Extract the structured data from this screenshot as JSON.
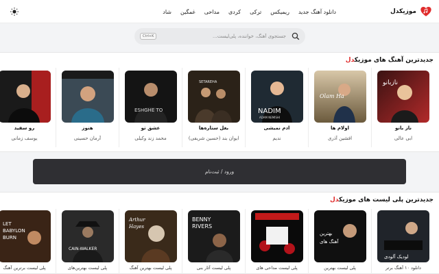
{
  "header": {
    "brand": "موزیکدل",
    "nav": [
      "دانلود آهنگ جدید",
      "ریمیکس",
      "ترکی",
      "کردی",
      "مداحی",
      "غمگین",
      "شاد"
    ],
    "theme_icon": "sun-icon",
    "logo_color": "#e02b2b"
  },
  "search": {
    "placeholder": "جستجوی آهنگ، خواننده، پلی‌لیست...",
    "shortcut": "Ctrl+K"
  },
  "latest_songs": {
    "title_main": "جدیدترین آهنگ های موزیک",
    "title_accent": "دل",
    "items": [
      {
        "title": "ناز بانو",
        "artist": "ابی عالی"
      },
      {
        "title": "اولام ها",
        "artist": "افشین آذری"
      },
      {
        "title": "آدم نمیشی",
        "artist": "ندیم"
      },
      {
        "title": "بغل ستاره‌ها",
        "artist": "ایوان بند (حسین شریفی)"
      },
      {
        "title": "عشق تو",
        "artist": "محمد زند وکیلی"
      },
      {
        "title": "هنوز",
        "artist": "آرمان حسینی"
      },
      {
        "title": "رو سفید",
        "artist": "یوسف زمانی"
      }
    ]
  },
  "login": {
    "label": "ورود / ثبت‌نام"
  },
  "latest_playlists": {
    "title_main": "جدیدترین پلی لیست های موزیک",
    "title_accent": "دل",
    "items": [
      {
        "title": "دانلود ۱۰ آهنگ برتر"
      },
      {
        "title": "پلی لیست بهترین"
      },
      {
        "title": "پلی لیست مداحی های"
      },
      {
        "title": "پلی لیست آثار بنی"
      },
      {
        "title": "پلی لیست بهترین آهنگ"
      },
      {
        "title": "پلی لیست بهترین‌های"
      },
      {
        "title": "پلی لیست برترین آهنگ"
      }
    ]
  },
  "colors": {
    "accent": "#e02b2b",
    "login_bar": "#2f2f33"
  }
}
